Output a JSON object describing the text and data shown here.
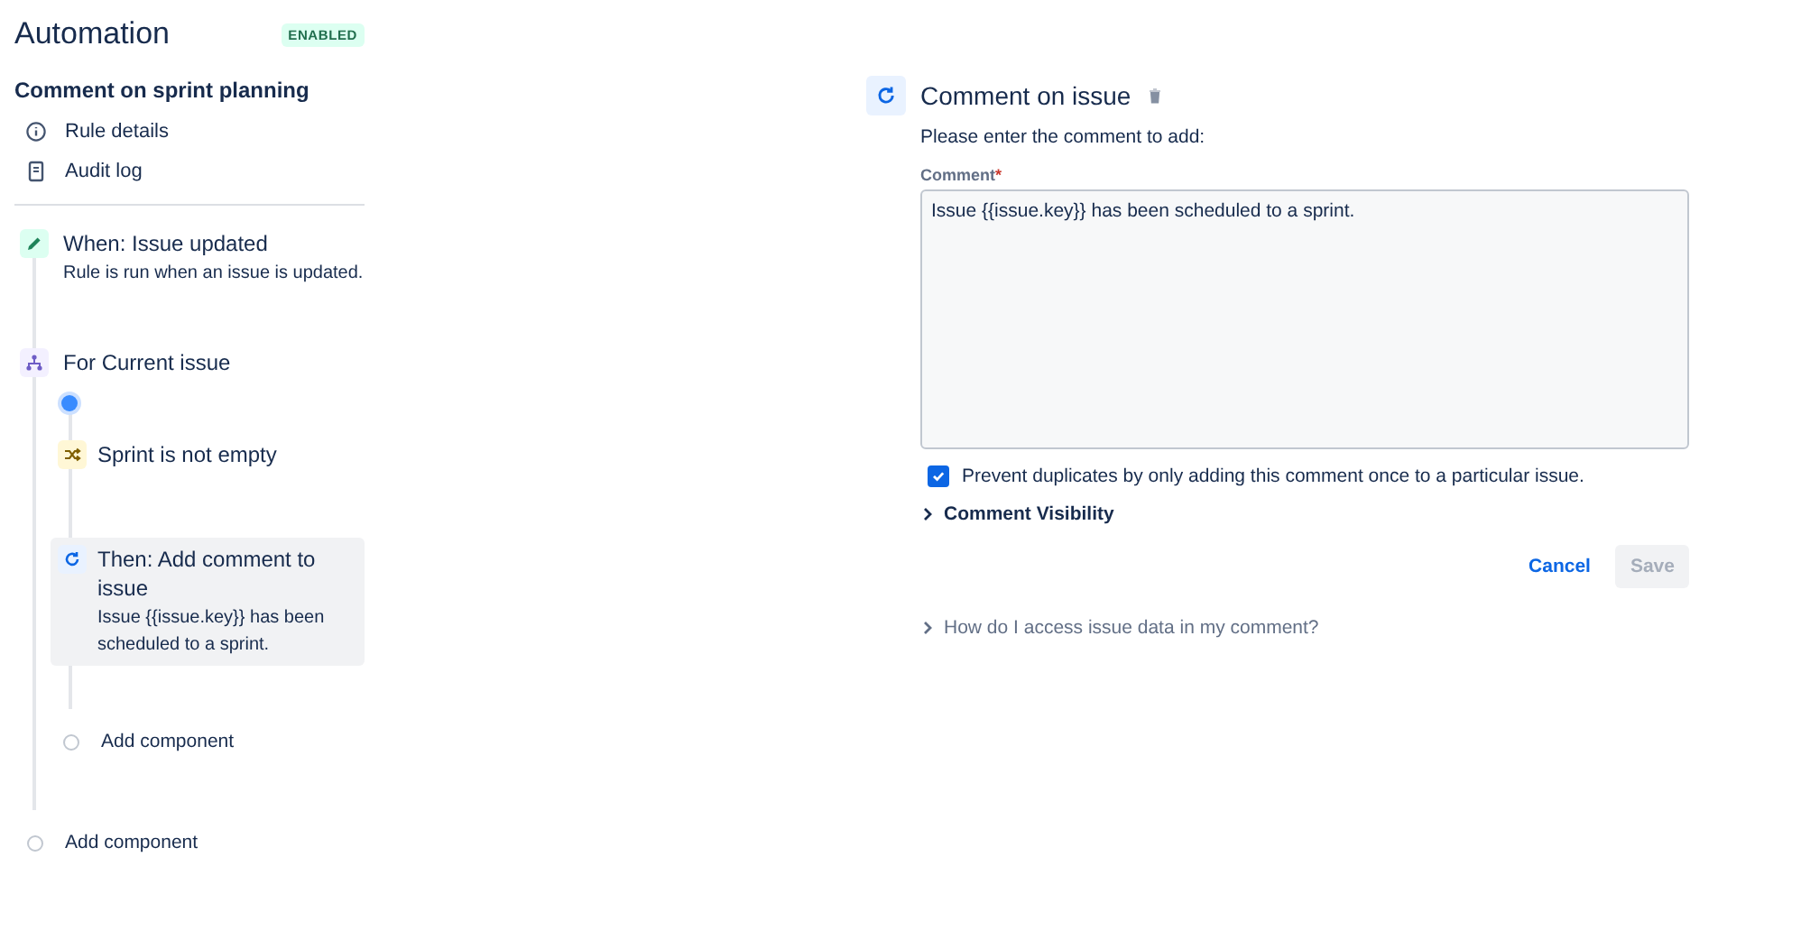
{
  "header": {
    "title": "Automation",
    "status": "ENABLED"
  },
  "rule": {
    "name": "Comment on sprint planning",
    "links": [
      {
        "label": "Rule details",
        "kind": "info"
      },
      {
        "label": "Audit log",
        "kind": "log"
      }
    ]
  },
  "trigger": {
    "title": "When: Issue updated",
    "description": "Rule is run when an issue is updated."
  },
  "branch": {
    "title": "For Current issue",
    "steps": [
      {
        "kind": "condition",
        "title": "Sprint is not empty",
        "selected": false
      },
      {
        "kind": "action",
        "title": "Then: Add comment to issue",
        "description": "Issue {{issue.key}} has been scheduled to a sprint.",
        "selected": true
      }
    ],
    "add_label": "Add component"
  },
  "add_label": "Add component",
  "editor": {
    "title": "Comment on issue",
    "intro": "Please enter the comment to add:",
    "field_label": "Comment",
    "required_mark": "*",
    "value": "Issue {{issue.key}} has been scheduled to a sprint.",
    "prevent_duplicates": {
      "label": "Prevent duplicates by only adding this comment once to a particular issue.",
      "checked": true
    },
    "visibility": {
      "label": "Comment Visibility",
      "expanded": false
    },
    "buttons": [
      {
        "label": "Cancel",
        "kind": "link",
        "disabled": false
      },
      {
        "label": "Save",
        "kind": "primary",
        "disabled": true
      }
    ],
    "help": {
      "label": "How do I access issue data in my comment?",
      "expanded": false
    }
  }
}
